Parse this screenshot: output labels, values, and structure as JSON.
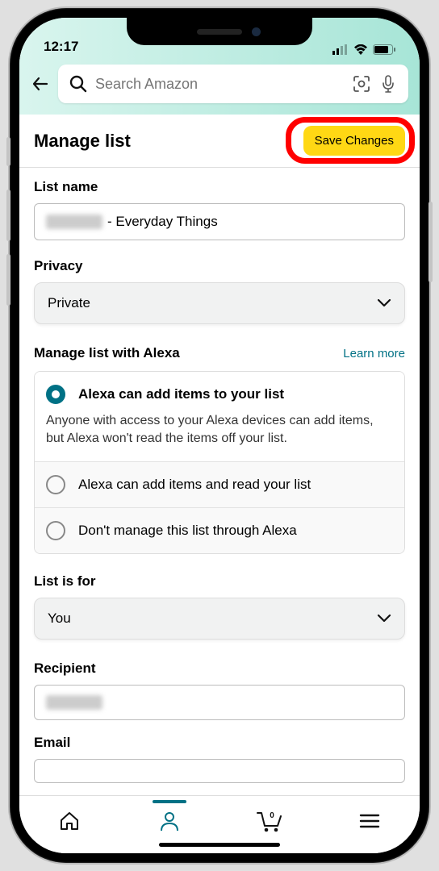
{
  "status": {
    "time": "12:17"
  },
  "search": {
    "placeholder": "Search Amazon"
  },
  "header": {
    "title": "Manage list",
    "save_label": "Save Changes"
  },
  "listName": {
    "label": "List name",
    "suffix": "- Everyday Things"
  },
  "privacy": {
    "label": "Privacy",
    "selected": "Private"
  },
  "alexa": {
    "header": "Manage list with Alexa",
    "learn_more": "Learn more",
    "options": [
      {
        "label": "Alexa can add items to your list",
        "desc": "Anyone with access to your Alexa devices can add items, but Alexa won't read the items off your list."
      },
      {
        "label": "Alexa can add items and read your list"
      },
      {
        "label": "Don't manage this list through Alexa"
      }
    ]
  },
  "listFor": {
    "label": "List is for",
    "selected": "You"
  },
  "recipient": {
    "label": "Recipient"
  },
  "email": {
    "label": "Email"
  },
  "nav": {
    "cart_badge": "0"
  }
}
